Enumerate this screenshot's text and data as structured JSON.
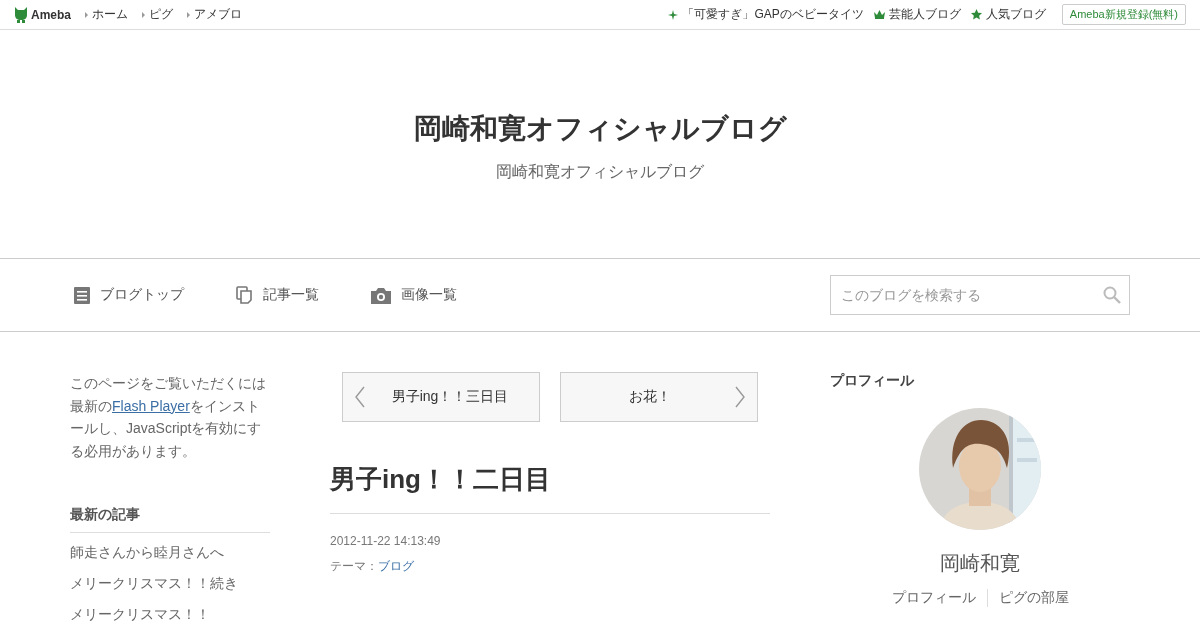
{
  "top_bar": {
    "logo": "Ameba",
    "links": [
      {
        "label": "ホーム"
      },
      {
        "label": "ピグ"
      },
      {
        "label": "アメブロ"
      }
    ],
    "promos": [
      {
        "kind": "sparkle",
        "label": "「可愛すぎ」GAPのベビータイツ"
      },
      {
        "kind": "crown",
        "label": "芸能人ブログ"
      },
      {
        "kind": "star",
        "label": "人気ブログ"
      }
    ],
    "register_button": "Ameba新規登録(無料)"
  },
  "header": {
    "title": "岡崎和寛オフィシャルブログ",
    "subtitle": "岡崎和寛オフィシャルブログ"
  },
  "nav": {
    "items": [
      {
        "kind": "doc",
        "label": "ブログトップ"
      },
      {
        "kind": "pages",
        "label": "記事一覧"
      },
      {
        "kind": "camera",
        "label": "画像一覧"
      }
    ],
    "search": {
      "placeholder": "このブログを検索する"
    }
  },
  "left": {
    "notice_before": "このページをご覧いただくには最新の",
    "notice_link": "Flash Player",
    "notice_after": "をインストールし、JavaScriptを有効にする必用があります。",
    "recent_heading": "最新の記事",
    "recent": [
      {
        "title": "師走さんから睦月さんへ"
      },
      {
        "title": "メリークリスマス！！続き"
      },
      {
        "title": "メリークリスマス！！"
      }
    ]
  },
  "article": {
    "prev": "男子ing！！三日目",
    "next": "お花！",
    "title": "男子ing！！二日目",
    "date": "2012-11-22 14:13:49",
    "theme_label": "テーマ：",
    "theme": "ブログ"
  },
  "profile": {
    "heading": "プロフィール",
    "name": "岡崎和寛",
    "links": [
      {
        "label": "プロフィール"
      },
      {
        "label": "ピグの部屋"
      }
    ]
  }
}
